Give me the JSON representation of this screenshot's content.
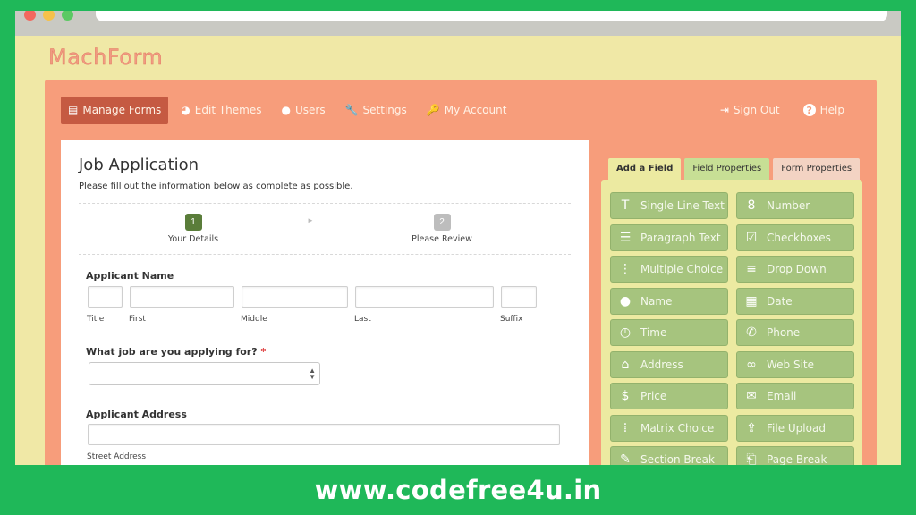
{
  "logo": "MachForm",
  "colors": {
    "outer_green": "#1fb859",
    "panel": "#f79d7b",
    "accent_green": "#a6c47e"
  },
  "nav": {
    "items": [
      {
        "label": "Manage Forms",
        "icon": "document-icon",
        "glyph": "▤"
      },
      {
        "label": "Edit Themes",
        "icon": "palette-icon",
        "glyph": "◕"
      },
      {
        "label": "Users",
        "icon": "user-icon",
        "glyph": "●"
      },
      {
        "label": "Settings",
        "icon": "wrench-icon",
        "glyph": "🔧"
      },
      {
        "label": "My Account",
        "icon": "key-icon",
        "glyph": "🔑"
      }
    ],
    "right": [
      {
        "label": "Sign Out",
        "icon": "sign-out-icon",
        "glyph": "⇥"
      },
      {
        "label": "Help",
        "icon": "help-icon",
        "glyph": "?"
      }
    ]
  },
  "form": {
    "title": "Job Application",
    "description": "Please fill out the information below as complete as possible.",
    "steps": [
      {
        "num": "1",
        "label": "Your Details"
      },
      {
        "num": "2",
        "label": "Please Review"
      }
    ],
    "step_arrow": "►",
    "applicant_name": {
      "label": "Applicant Name",
      "sublabels": [
        "Title",
        "First",
        "Middle",
        "Last",
        "Suffix"
      ]
    },
    "job_question": {
      "label": "What job are you applying for?",
      "required_mark": "*"
    },
    "applicant_address": {
      "label": "Applicant Address",
      "sublabel": "Street Address"
    }
  },
  "tabs": [
    "Add a Field",
    "Field Properties",
    "Form Properties"
  ],
  "fields": [
    {
      "label": "Single Line Text",
      "icon": "text-icon",
      "glyph": "T"
    },
    {
      "label": "Number",
      "icon": "number-icon",
      "glyph": "8"
    },
    {
      "label": "Paragraph Text",
      "icon": "paragraph-icon",
      "glyph": "☰"
    },
    {
      "label": "Checkboxes",
      "icon": "checkbox-icon",
      "glyph": "☑"
    },
    {
      "label": "Multiple Choice",
      "icon": "list-icon",
      "glyph": "⋮"
    },
    {
      "label": "Drop Down",
      "icon": "dropdown-icon",
      "glyph": "≡"
    },
    {
      "label": "Name",
      "icon": "person-icon",
      "glyph": "●"
    },
    {
      "label": "Date",
      "icon": "calendar-icon",
      "glyph": "▦"
    },
    {
      "label": "Time",
      "icon": "alarm-clock-icon",
      "glyph": "◷"
    },
    {
      "label": "Phone",
      "icon": "phone-icon",
      "glyph": "✆"
    },
    {
      "label": "Address",
      "icon": "home-icon",
      "glyph": "⌂"
    },
    {
      "label": "Web Site",
      "icon": "link-icon",
      "glyph": "∞"
    },
    {
      "label": "Price",
      "icon": "money-icon",
      "glyph": "$"
    },
    {
      "label": "Email",
      "icon": "envelope-icon",
      "glyph": "✉"
    },
    {
      "label": "Matrix Choice",
      "icon": "grid-icon",
      "glyph": "⁞"
    },
    {
      "label": "File Upload",
      "icon": "upload-icon",
      "glyph": "⇪"
    },
    {
      "label": "Section Break",
      "icon": "pencil-icon",
      "glyph": "✎"
    },
    {
      "label": "Page Break",
      "icon": "page-icon",
      "glyph": "⎗"
    }
  ],
  "banner": "www.codefree4u.in"
}
